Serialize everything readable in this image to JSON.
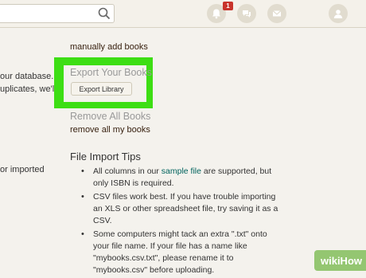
{
  "topbar": {
    "search_placeholder": "",
    "notification_count": "1"
  },
  "left": {
    "lines": [
      "our database. If",
      "uplicates, we'll",
      "or imported"
    ]
  },
  "right": {
    "manual_link": "manually add books",
    "export_heading": "Export Your Books",
    "export_button": "Export Library",
    "remove_heading": "Remove All Books",
    "remove_link": "remove all my books"
  },
  "tips": {
    "heading": "File Import Tips",
    "item1_pre": "All columns in our ",
    "item1_link": "sample file",
    "item1_post": " are supported, but only ISBN is required.",
    "item2": "CSV files work best. If you have trouble importing an XLS or other spreadsheet file, try saving it as a CSV.",
    "item3": "Some computers might tack an extra \".txt\" onto your file name. If your file has a name like \"mybooks.csv.txt\", please rename it to \"mybooks.csv\" before uploading."
  },
  "watermark": {
    "text": "wikiHow"
  },
  "colors": {
    "highlight": "#3dde14",
    "link": "#382110",
    "badge": "#c8332b"
  }
}
